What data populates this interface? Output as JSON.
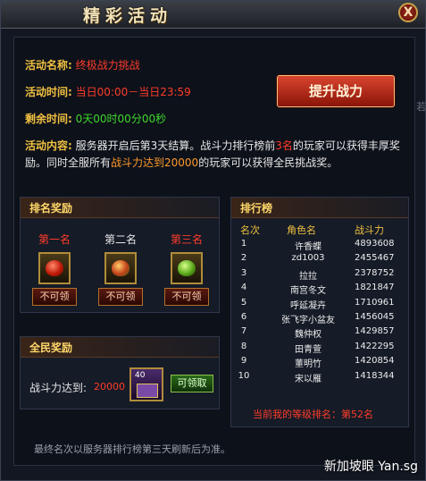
{
  "window": {
    "title": "精彩活动",
    "close_label": "X"
  },
  "activity": {
    "name_label": "活动名称:",
    "name_value": "终极战力挑战",
    "time_label": "活动时间:",
    "time_value": "当日00:00－当日23:59",
    "remain_label": "剩余时间:",
    "remain_value": "0天00时00分00秒",
    "content_label": "活动内容:",
    "content_p1": "服务器开启后第3天结算。战斗力排行榜前",
    "content_top": "3名",
    "content_p2": "的玩家可以获得丰厚奖励。同时全服所有",
    "content_cond": "战斗力达到20000",
    "content_p3": "的玩家可以获得全民挑战奖。"
  },
  "boost_button": "提升战力",
  "rank_reward": {
    "title": "排名奖励",
    "items": [
      {
        "name": "第一名",
        "button": "不可领",
        "gem": "red-gem"
      },
      {
        "name": "第二名",
        "button": "不可领",
        "gem": "orange-gem"
      },
      {
        "name": "第三名",
        "button": "不可领",
        "gem": "green-gem"
      }
    ]
  },
  "all_reward": {
    "title": "全民奖励",
    "label": "战斗力达到:",
    "value": "20000",
    "chest_badge": "40",
    "button": "可领取"
  },
  "leaderboard": {
    "title": "排行榜",
    "headers": [
      "名次",
      "角色名",
      "战斗力"
    ],
    "rows": [
      {
        "rank": "1",
        "name": "许香蝶",
        "power": "4893608"
      },
      {
        "rank": "2",
        "name": "zd1003",
        "power": "2455467"
      },
      {
        "rank": "3",
        "name": "拉拉",
        "power": "2378752"
      },
      {
        "rank": "4",
        "name": "南宫冬文",
        "power": "1821847"
      },
      {
        "rank": "5",
        "name": "呼延凝卉",
        "power": "1710961"
      },
      {
        "rank": "6",
        "name": "张飞字小盆友",
        "power": "1456045"
      },
      {
        "rank": "7",
        "name": "魏仲权",
        "power": "1429857"
      },
      {
        "rank": "8",
        "name": "田青萱",
        "power": "1422295"
      },
      {
        "rank": "9",
        "name": "董明竹",
        "power": "1420854"
      },
      {
        "rank": "10",
        "name": "宋以雁",
        "power": "1418344"
      }
    ],
    "my_rank": "当前我的等级排名：第52名"
  },
  "footer_note": "最终名次以服务器排行榜第三天刷新后为准。",
  "watermark": "新加坡眼 Yan.sg",
  "side_text": "若",
  "colors": {
    "accent_red": "#ff3c2a",
    "accent_gold": "#f0c040",
    "accent_green": "#3ed82a"
  }
}
